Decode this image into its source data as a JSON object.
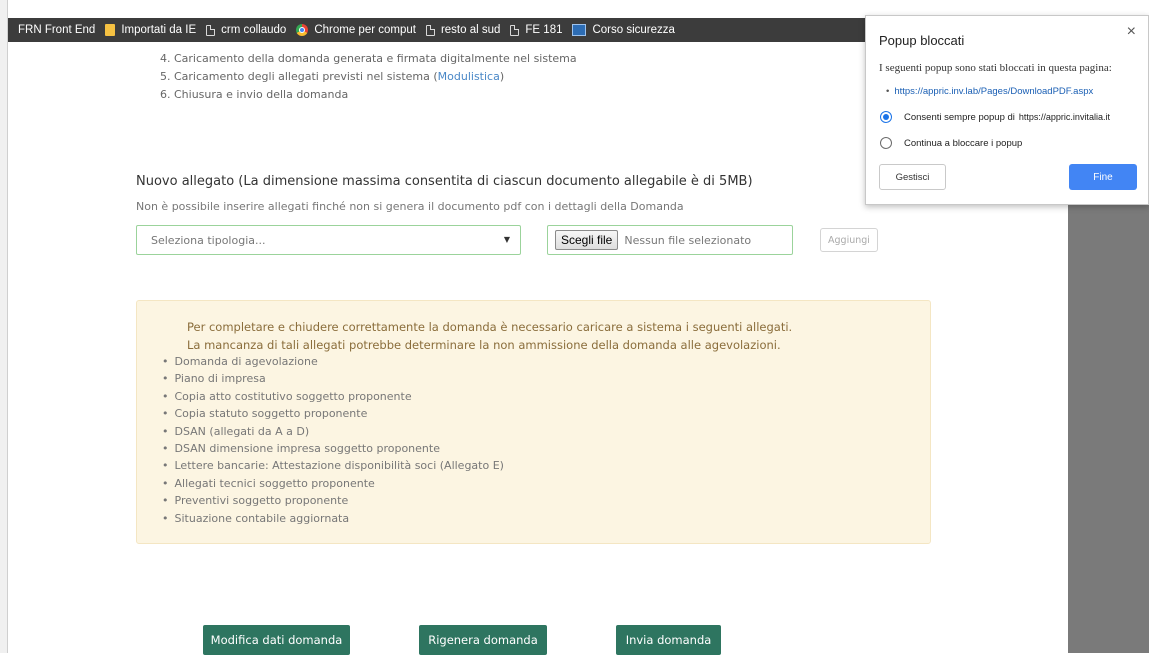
{
  "bookmarks": [
    {
      "label": "FRN Front End",
      "icon": "none"
    },
    {
      "label": "Importati da IE",
      "icon": "folder-icon"
    },
    {
      "label": "crm collaudo",
      "icon": "page-icon"
    },
    {
      "label": "Chrome per comput",
      "icon": "chrome-icon"
    },
    {
      "label": "resto al sud",
      "icon": "page-icon"
    },
    {
      "label": "FE 181",
      "icon": "page-icon"
    },
    {
      "label": "Corso sicurezza",
      "icon": "bookmark-blue-icon"
    }
  ],
  "steps": {
    "s4": "4. Caricamento della domanda generata e firmata digitalmente nel sistema",
    "s5_prefix": "5. Caricamento degli allegati previsti nel sistema (",
    "s5_link": "Modulistica",
    "s5_suffix": ")",
    "s6": "6. Chiusura e invio della domanda"
  },
  "attachment": {
    "title": "Nuovo allegato (La dimensione massima consentita di ciascun documento allegabile è di 5MB)",
    "subtitle": "Non è possibile inserire allegati finché non si genera il documento pdf con i dettagli della Domanda",
    "select_placeholder": "Seleziona tipologia...",
    "file_button": "Scegli file",
    "file_status": "Nessun file selezionato",
    "add_button": "Aggiungi"
  },
  "notice": {
    "line1": "Per completare e chiudere correttamente la domanda è necessario caricare a sistema i seguenti allegati.",
    "line2": "La mancanza di tali allegati potrebbe determinare la non ammissione della domanda alle agevolazioni.",
    "items": [
      "Domanda di agevolazione",
      "Piano di impresa",
      "Copia atto costitutivo soggetto proponente",
      "Copia statuto soggetto proponente",
      "DSAN (allegati da A a D)",
      "DSAN dimensione impresa soggetto proponente",
      "Lettere bancarie: Attestazione disponibilità soci (Allegato E)",
      "Allegati tecnici soggetto proponente",
      "Preventivi soggetto proponente",
      "Situazione contabile aggiornata"
    ]
  },
  "actions": {
    "modify": "Modifica dati domanda",
    "regenerate": "Rigenera domanda",
    "send": "Invia domanda"
  },
  "popup": {
    "title": "Popup bloccati",
    "close": "×",
    "description": "I seguenti popup sono stati bloccati in questa pagina:",
    "link": "https://appric.inv.lab/Pages/DownloadPDF.aspx",
    "option_allow": "Consenti sempre popup di",
    "option_allow_domain": "https://appric.invitalia.it",
    "option_block": "Continua a bloccare i popup",
    "manage_button": "Gestisci",
    "done_button": "Fine"
  }
}
